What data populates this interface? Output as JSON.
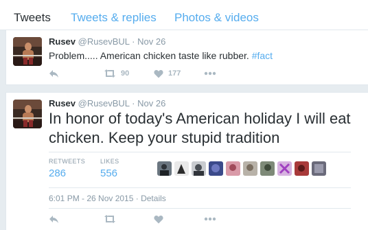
{
  "tabs": [
    {
      "label": "Tweets",
      "active": true
    },
    {
      "label": "Tweets & replies",
      "active": false
    },
    {
      "label": "Photos & videos",
      "active": false
    }
  ],
  "tweets": [
    {
      "name": "Rusev",
      "handle": "@RusevBUL",
      "date": "Nov 26",
      "text": "Problem..... American chicken taste like rubber.",
      "hashtag": "#fact",
      "retweets": "90",
      "likes": "177"
    },
    {
      "name": "Rusev",
      "handle": "@RusevBUL",
      "date": "Nov 26",
      "text": "In honor of today's American holiday I will eat chicken. Keep your stupid tradition",
      "retweets_label": "RETWEETS",
      "retweets": "286",
      "likes_label": "LIKES",
      "likes": "556",
      "timestamp": "6:01 PM - 26 Nov 2015",
      "details_label": "Details"
    }
  ],
  "colors": {
    "accent": "#55acee",
    "muted": "#8899a6",
    "icon": "#aab8c2",
    "text": "#292f33",
    "background": "#e6ecf0"
  }
}
